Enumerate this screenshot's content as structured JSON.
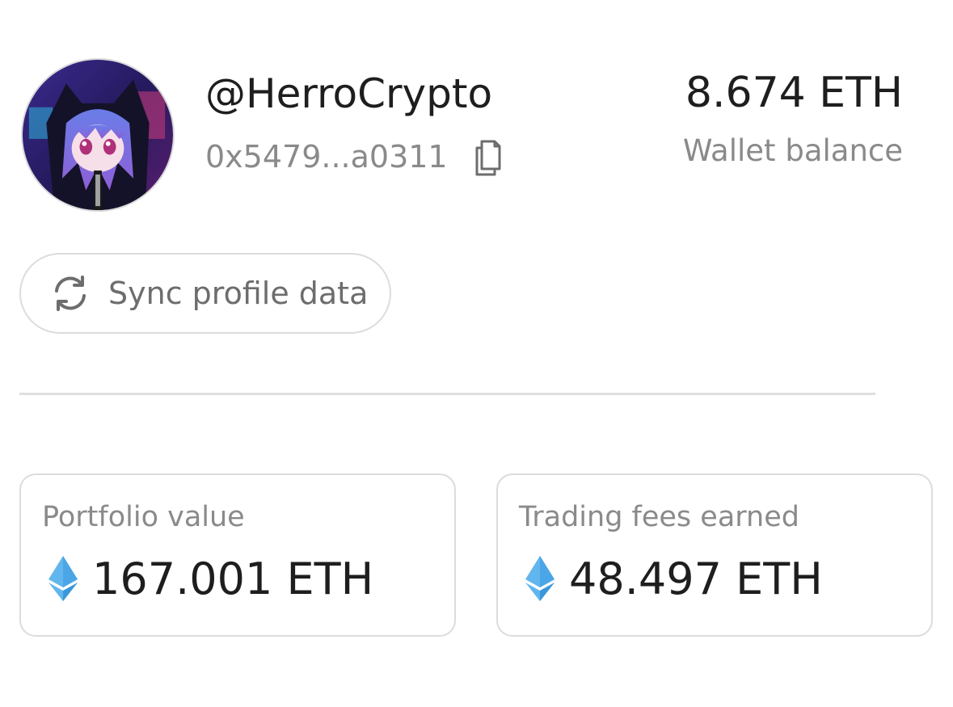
{
  "profile": {
    "username": "@HerroCrypto",
    "address": "0x5479...a0311",
    "avatar_icon": "anime-avatar-image",
    "copy_icon": "copy-icon"
  },
  "wallet": {
    "balance": "8.674 ETH",
    "label": "Wallet balance"
  },
  "actions": {
    "sync_label": "Sync profile data",
    "sync_icon": "refresh-icon"
  },
  "stats": [
    {
      "label": "Portfolio value",
      "value": "167.001 ETH",
      "icon": "ethereum-icon"
    },
    {
      "label": "Trading fees earned",
      "value": "48.497 ETH",
      "icon": "ethereum-icon"
    }
  ],
  "colors": {
    "eth_blue": "#62b6ee",
    "eth_blue_dark": "#3a97d9",
    "muted_text": "#8a8a8a",
    "primary_text": "#1e1e1e",
    "border": "#dcdcdc"
  }
}
